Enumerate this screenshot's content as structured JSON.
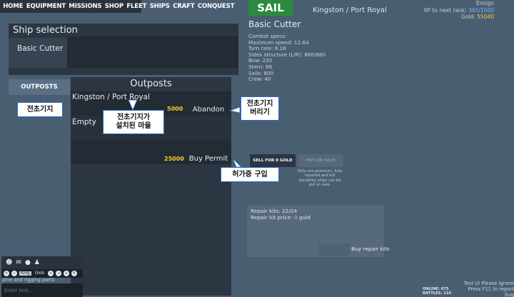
{
  "topnav": [
    "HOME",
    "EQUIPMENT",
    "MISSIONS",
    "SHOP",
    "FLEET",
    "SHIPS",
    "CRAFT",
    "CONQUEST"
  ],
  "sail_label": "SAIL",
  "location": "Kingston / Port Royal",
  "rank": {
    "title": "Ensign",
    "xp_label": "XP to next rank:",
    "xp_value": "365/1000",
    "gold_label": "Gold:",
    "gold_value": "55040"
  },
  "ship_selection": {
    "title": "Ship selection",
    "ship": "Basic Cutter"
  },
  "outposts_tab": "OUTPOSTS",
  "outposts": {
    "title": "Outposts",
    "rows": [
      {
        "name": "Kingston / Port Royal",
        "price": "5000",
        "action": "Abandon"
      },
      {
        "name": "Empty"
      },
      {
        "price": "25000",
        "action": "Buy Permit"
      }
    ]
  },
  "annotations": {
    "outposts": "전초기지",
    "village": "전초기지가\n설치된 마을",
    "abandon": "전초기지\n버리기",
    "buy": "허가증 구입"
  },
  "ship_info": {
    "name": "Basic Cutter",
    "specs": [
      "Combat specs:",
      "Maximum speed: 12.64",
      "Turn rate: 6.18",
      "Sides structure (L/R): 880/880",
      "Bow: 220",
      "Stern: 88",
      "Sails: 800",
      "Crew: 40"
    ]
  },
  "sell": {
    "btn1": "SELL FOR 0 GOLD",
    "btn2": "PUT ON SALE",
    "note": "Only non-premium, fully repaired and full durability ships can be put on sale."
  },
  "repair": {
    "kits_label": "Repair kits:",
    "kits_value": "22/24",
    "price_label": "Repair kit price:",
    "price_value": "0",
    "price_unit": "gold",
    "buy_label": "Buy repair kits"
  },
  "chat": {
    "channels": [
      "King",
      "Glob"
    ],
    "message": "pine and rigging parts",
    "placeholder": "Enter text..."
  },
  "status": {
    "online": "ONLINE: 675",
    "battles": "BATTLES: 216",
    "bug1": "Test UI Please ignore",
    "bug2": "Press F11 to report bug"
  }
}
